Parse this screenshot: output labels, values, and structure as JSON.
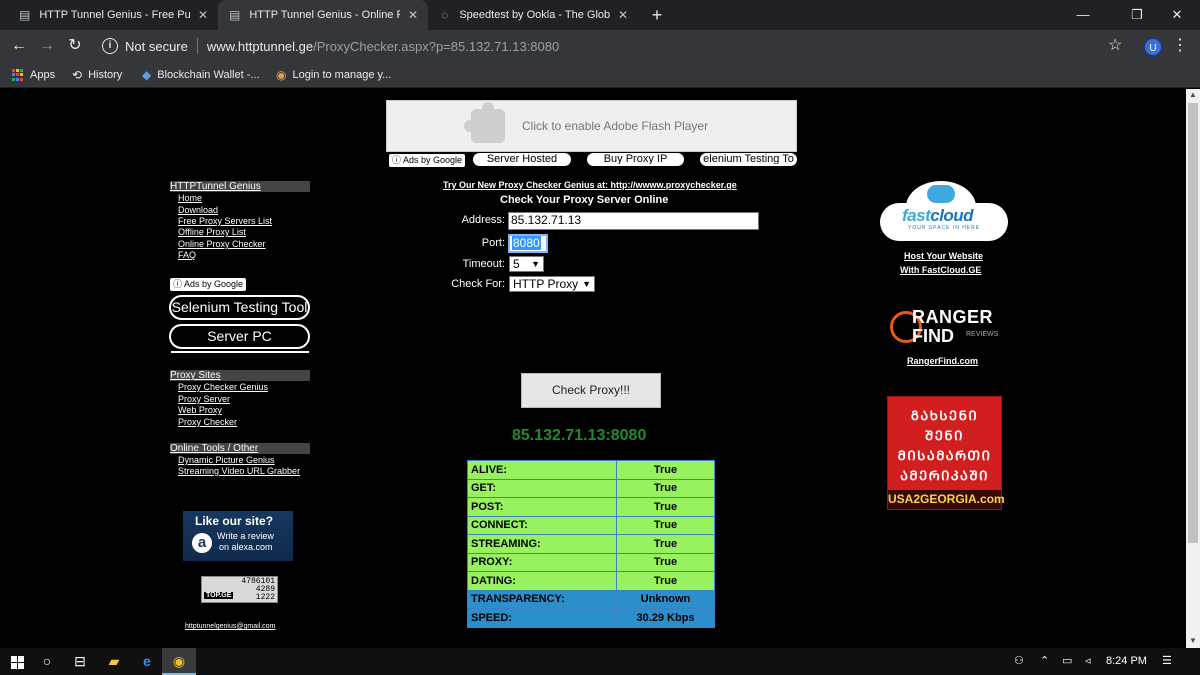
{
  "browser": {
    "tabs": [
      {
        "title": "HTTP Tunnel Genius - Free Public",
        "icon": "document-icon",
        "active": false
      },
      {
        "title": "HTTP Tunnel Genius - Online Pro",
        "icon": "document-icon",
        "active": true
      },
      {
        "title": "Speedtest by Ookla - The Global",
        "icon": "loading-icon",
        "active": false
      }
    ],
    "new_tab": "+",
    "window_controls": {
      "minimize": "—",
      "maximize": "❐",
      "close": "✕"
    },
    "nav": {
      "back": "←",
      "forward": "→",
      "reload": "↻"
    },
    "security_label": "Not secure",
    "url_host": "www.httptunnel.ge",
    "url_rest": "/ProxyChecker.aspx?p=85.132.71.13:8080",
    "profile_initial": "U",
    "bookmarks": [
      {
        "label": "Apps",
        "icon": "apps-grid-icon"
      },
      {
        "label": "History",
        "icon": "history-icon"
      },
      {
        "label": "Blockchain Wallet -...",
        "icon": "blockchain-icon"
      },
      {
        "label": "Login to manage y...",
        "icon": "login-icon"
      }
    ]
  },
  "flash_placeholder": "Click to enable Adobe Flash Player",
  "top_ads": {
    "ads_by_google": "ⓘ Ads by Google",
    "links": [
      "Server Hosted",
      "Buy Proxy IP",
      "elenium Testing To"
    ]
  },
  "sidebar": {
    "sections": [
      {
        "title": "HTTPTunnel Genius",
        "links": [
          "Home",
          "Download",
          "Free Proxy Servers List",
          "Offline Proxy List",
          "Online Proxy Checker",
          "FAQ"
        ]
      },
      {
        "title": "Proxy Sites",
        "links": [
          "Proxy Checker Genius",
          "Proxy Server",
          "Web Proxy",
          "Proxy Checker"
        ]
      },
      {
        "title": "Online Tools / Other",
        "links": [
          "Dynamic Picture Genius",
          "Streaming Video URL Grabber"
        ]
      }
    ],
    "ads_by_google": "ⓘ Ads by Google",
    "ad_pills": [
      "Selenium Testing Tool",
      "Server PC"
    ],
    "alexa": {
      "title": "Like our site?",
      "line1": "Write a review",
      "line2": "on alexa.com",
      "logo": "a"
    },
    "topge": {
      "label": "TOP.GE",
      "numbers": [
        "4786101",
        "4289",
        "1222"
      ]
    },
    "email": "httptunnelgenius@gmail.com"
  },
  "checker": {
    "promo": "Try Our New Proxy Checker Genius at: http://wwww.proxychecker.ge",
    "title": "Check Your Proxy Server Online",
    "address_label": "Address:",
    "address_value": "85.132.71.13",
    "port_label": "Port:",
    "port_value": "8080",
    "timeout_label": "Timeout:",
    "timeout_value": "5",
    "checkfor_label": "Check For:",
    "checkfor_value": "HTTP Proxy",
    "button": "Check Proxy!!!",
    "result_ip": "85.132.71.13:8080",
    "results": [
      {
        "label": "ALIVE:",
        "value": "True",
        "kind": "ok"
      },
      {
        "label": "GET:",
        "value": "True",
        "kind": "ok"
      },
      {
        "label": "POST:",
        "value": "True",
        "kind": "ok"
      },
      {
        "label": "CONNECT:",
        "value": "True",
        "kind": "ok"
      },
      {
        "label": "STREAMING:",
        "value": "True",
        "kind": "ok"
      },
      {
        "label": "PROXY:",
        "value": "True",
        "kind": "ok"
      },
      {
        "label": "DATING:",
        "value": "True",
        "kind": "ok"
      },
      {
        "label": "TRANSPARENCY:",
        "value": "Unknown",
        "kind": "info"
      },
      {
        "label": "SPEED:",
        "value": "30.29 Kbps",
        "kind": "info"
      }
    ]
  },
  "right_ads": {
    "fastcloud": {
      "logo_a": "fast",
      "logo_b": "cloud",
      "tagline": "YOUR SPACE IN HERE",
      "line1": "Host Your Website",
      "line2": "With FastCloud.GE"
    },
    "ranger": {
      "line1": "RANGER",
      "line2": "FIND",
      "line3": "REVIEWS",
      "link": "RangerFind.com"
    },
    "usa": {
      "lines": [
        "ᲒᲐᲮᲡᲔᲜᲘ",
        "ᲨᲔᲜᲘ",
        "ᲛᲘᲡᲐᲛᲐᲠᲗᲘ",
        "ᲐᲛᲔᲠᲘᲙᲐᲨᲘ"
      ],
      "footer": "USA2GEORGIA.com"
    }
  },
  "taskbar": {
    "time": "8:24 PM"
  }
}
